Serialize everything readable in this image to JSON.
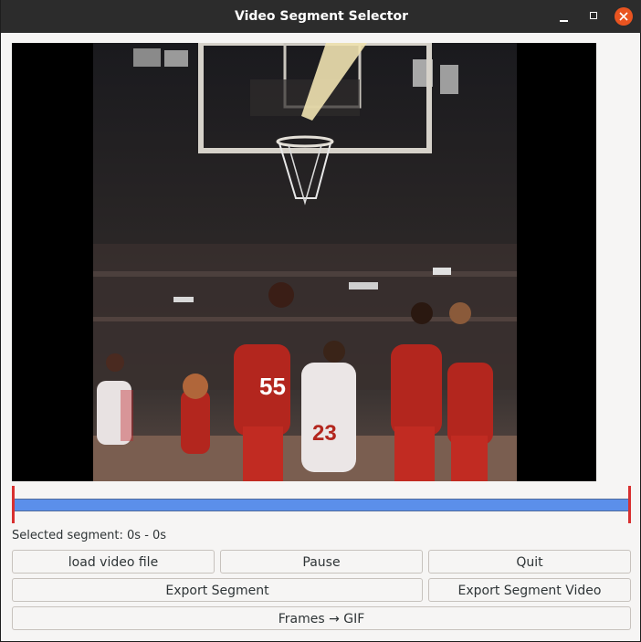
{
  "window": {
    "title": "Video Segment Selector"
  },
  "controls": {
    "status": "Selected segment: 0s - 0s",
    "load": "load video file",
    "pause": "Pause",
    "quit": "Quit",
    "export_segment": "Export Segment",
    "export_segment_video": "Export Segment Video",
    "frames_gif": "Frames → GIF"
  },
  "colors": {
    "titlebar": "#2c2c2c",
    "close": "#e95420",
    "track": "#5b8fea",
    "handle": "#d83030"
  },
  "icons": [
    "minimize-icon",
    "maximize-icon",
    "close-icon"
  ]
}
